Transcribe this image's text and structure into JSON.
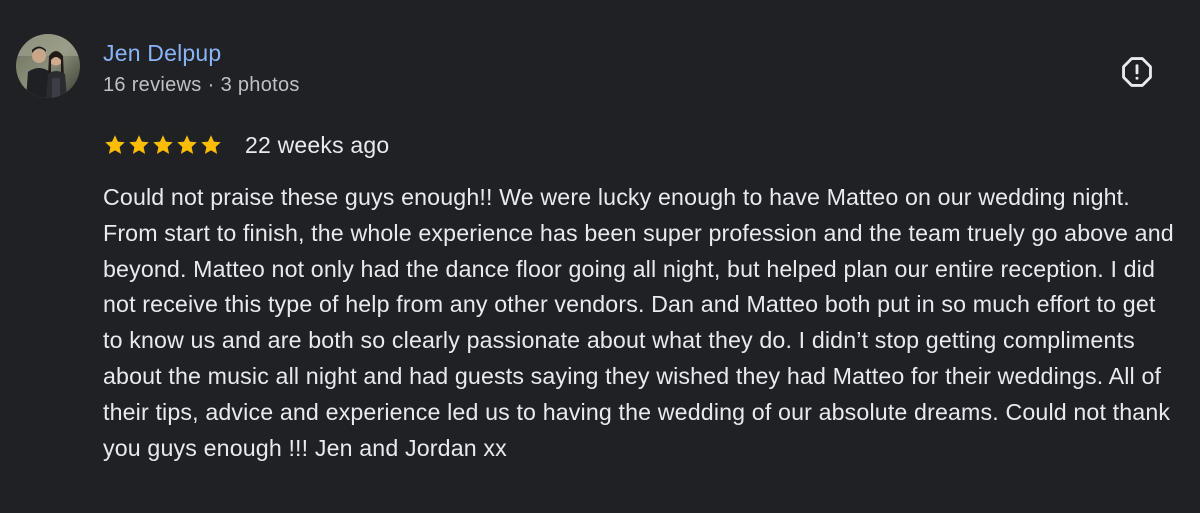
{
  "review": {
    "author": {
      "name": "Jen Delpup",
      "reviews_count": "16 reviews",
      "separator": "·",
      "photos_count": "3 photos"
    },
    "rating": 5,
    "date": "22 weeks ago",
    "text": "Could not praise these guys enough!! We were lucky enough to have Matteo on our wedding night. From start to finish, the whole experience has been super profession and the team truely go above and beyond. Matteo not only had the dance floor going all night, but helped plan our entire reception. I did not receive this type of help from any other vendors. Dan and Matteo both put in so much effort to get to know us and are both so clearly passionate about what they do. I didn’t stop getting compliments about the music all night and had guests saying they wished they had Matteo for their weddings. All of their tips, advice and experience led us to having the wedding of our absolute dreams. Could not thank you guys enough !!! Jen and Jordan xx"
  },
  "icons": {
    "report": "report-flag-icon",
    "star": "star-icon"
  },
  "colors": {
    "background": "#202124",
    "author_link": "#8ab4f8",
    "meta_text": "#bdc1c6",
    "body_text": "#e8eaed",
    "star": "#fbbc04",
    "icon": "#e8eaed"
  }
}
